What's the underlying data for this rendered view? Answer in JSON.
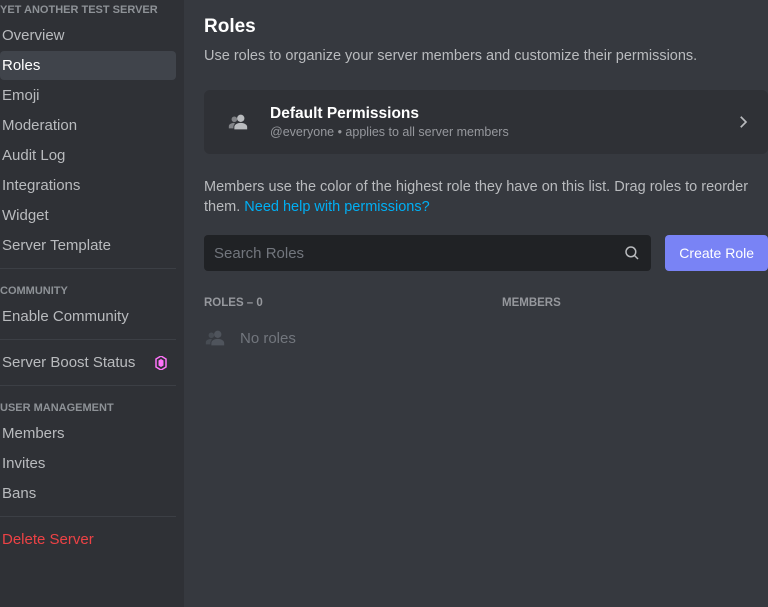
{
  "sidebar": {
    "server_name": "YET ANOTHER TEST SERVER",
    "section_main": [
      {
        "label": "Overview"
      },
      {
        "label": "Roles",
        "active": true
      },
      {
        "label": "Emoji"
      },
      {
        "label": "Moderation"
      },
      {
        "label": "Audit Log"
      },
      {
        "label": "Integrations"
      },
      {
        "label": "Widget"
      },
      {
        "label": "Server Template"
      }
    ],
    "community_header": "Community",
    "section_community": [
      {
        "label": "Enable Community"
      }
    ],
    "boost": "Server Boost Status",
    "user_mgmt_header": "User Management",
    "section_user_mgmt": [
      {
        "label": "Members"
      },
      {
        "label": "Invites"
      },
      {
        "label": "Bans"
      }
    ],
    "delete": "Delete Server"
  },
  "main": {
    "title": "Roles",
    "subtitle": "Use roles to organize your server members and customize their permissions.",
    "card": {
      "title": "Default Permissions",
      "sub": "@everyone • applies to all server members"
    },
    "hint_text": "Members use the color of the highest role they have on this list. Drag roles to reorder them. ",
    "hint_link": "Need help with permissions?",
    "search_placeholder": "Search Roles",
    "create_role": "Create Role",
    "roles_count": 0,
    "roles_header": "Roles – 0",
    "members_header": "Members",
    "empty": "No roles"
  }
}
